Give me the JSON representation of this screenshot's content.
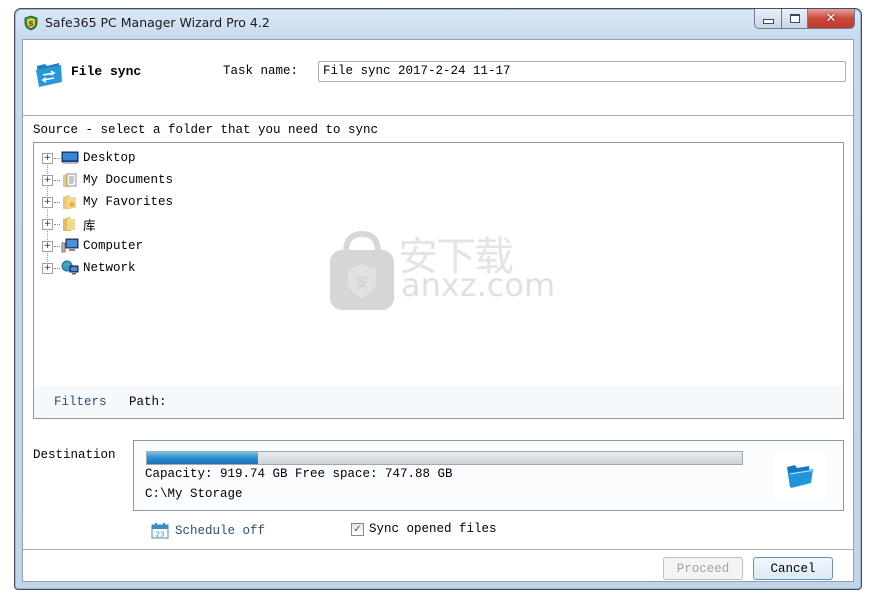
{
  "window": {
    "title": "Safe365 PC Manager Wizard Pro 4.2",
    "controls": {
      "minimize": "minimize",
      "maximize": "maximize",
      "close": "close"
    }
  },
  "header": {
    "title": "File sync",
    "task_name_label": "Task name:",
    "task_name_value": "File sync 2017-2-24 11-17"
  },
  "source": {
    "label": "Source - select a folder that you need to sync",
    "tree": [
      {
        "label": "Desktop",
        "icon": "desktop-icon"
      },
      {
        "label": "My Documents",
        "icon": "documents-folder-icon"
      },
      {
        "label": "My Favorites",
        "icon": "favorites-folder-icon"
      },
      {
        "label": "库",
        "icon": "library-folder-icon"
      },
      {
        "label": "Computer",
        "icon": "computer-icon"
      },
      {
        "label": "Network",
        "icon": "network-icon"
      }
    ],
    "filters_label": "Filters",
    "path_label": "Path:"
  },
  "destination": {
    "label": "Destination",
    "used_fraction": 0.187,
    "capacity_text": "Capacity: 919.74 GB  Free space: 747.88 GB",
    "path": "C:\\My Storage",
    "browse_icon": "folder-open-icon"
  },
  "options": {
    "schedule_label": "Schedule off",
    "sync_opened_label": "Sync opened files",
    "sync_opened_checked": true
  },
  "footer": {
    "proceed_label": "Proceed",
    "proceed_enabled": false,
    "cancel_label": "Cancel"
  },
  "watermark": {
    "cn_text": "安下载",
    "text": "anxz.com"
  }
}
